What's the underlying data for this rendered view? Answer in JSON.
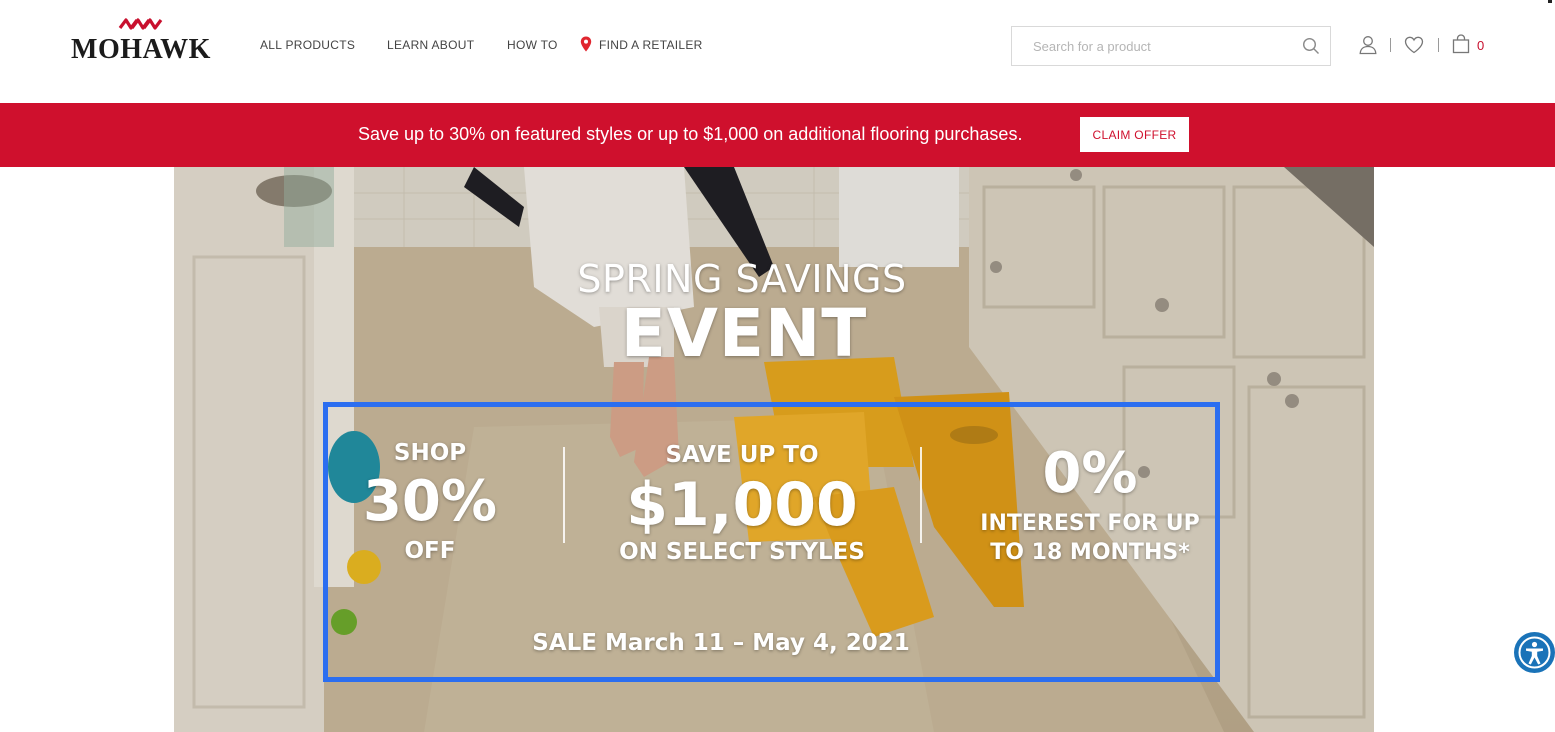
{
  "header": {
    "logo_text": "MOHAWK",
    "nav": [
      {
        "label": "ALL PRODUCTS"
      },
      {
        "label": "LEARN ABOUT"
      },
      {
        "label": "HOW TO"
      },
      {
        "label": "FIND A RETAILER",
        "icon": "map-pin-icon"
      }
    ],
    "search": {
      "placeholder": "Search for a product",
      "value": ""
    },
    "icons": [
      "user-icon",
      "heart-icon",
      "shopping-bag-icon"
    ],
    "cart_count": "0"
  },
  "promo_bar": {
    "text": "Save up to 30% on featured styles or up to $1,000 on additional flooring purchases.",
    "button_label": "CLAIM OFFER"
  },
  "hero": {
    "title_line1": "SPRING SAVINGS",
    "title_line2": "EVENT",
    "offers": [
      {
        "line1": "SHOP",
        "line2": "30%",
        "line3": "OFF"
      },
      {
        "line1": "SAVE UP TO",
        "line2": "$1,000",
        "line3": "ON SELECT STYLES"
      },
      {
        "line1": "0%",
        "line2": "INTEREST FOR UP",
        "line3": "TO 18 MONTHS*"
      }
    ],
    "sale_dates": "SALE March 11 – May 4, 2021"
  },
  "colors": {
    "brand_red": "#cf102d",
    "highlight_blue": "#2b6ef0",
    "accessibility_blue": "#1a73b8"
  },
  "accessibility": {
    "icon": "accessibility-icon"
  }
}
